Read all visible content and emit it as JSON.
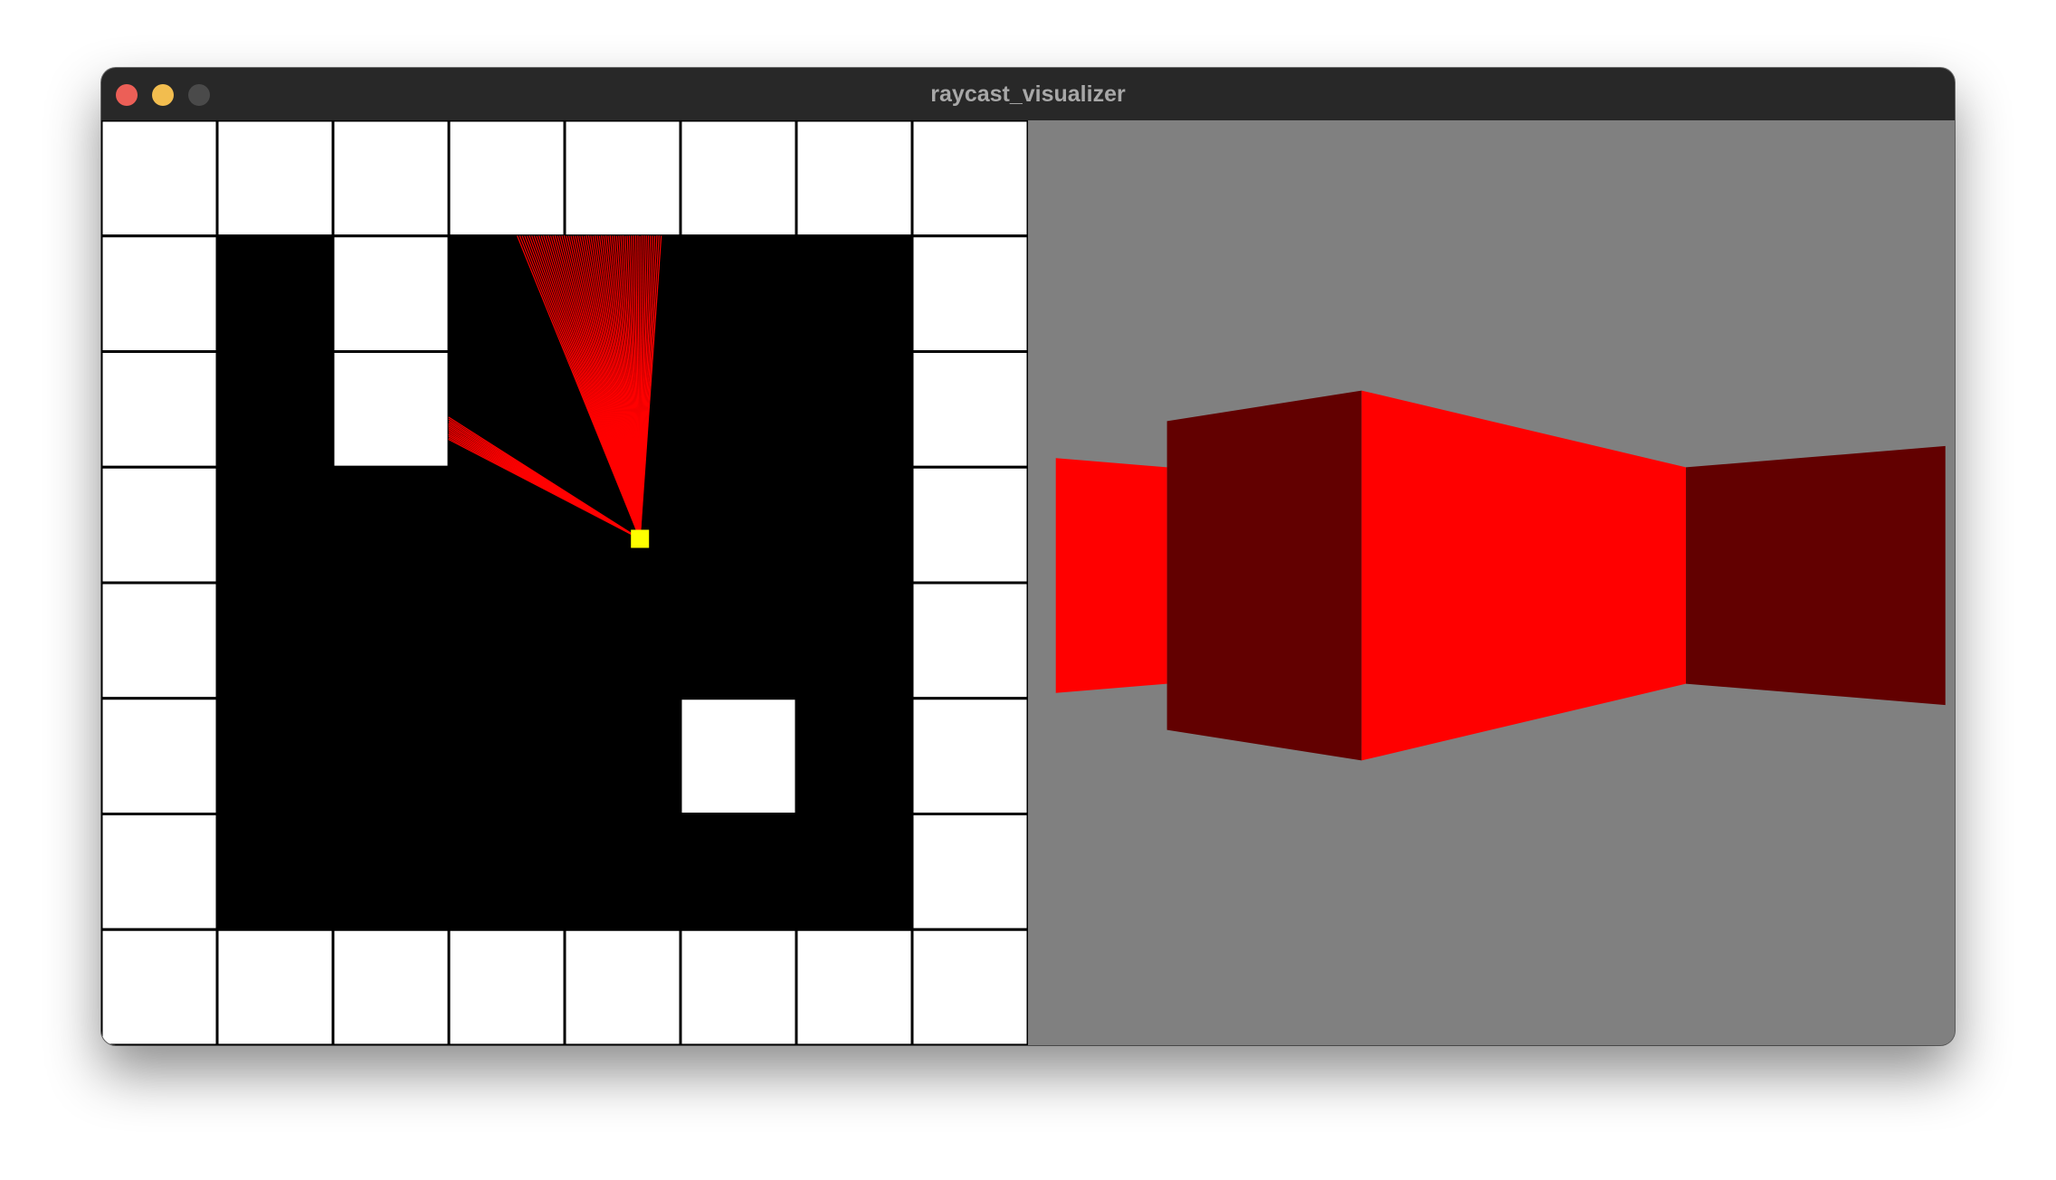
{
  "window": {
    "title": "raycast_visualizer",
    "traffic_lights": {
      "close_color": "#ec5f57",
      "minimize_color": "#f2bd4f",
      "zoom_color": "#4a4a4a"
    }
  },
  "map": {
    "rows": 8,
    "cols": 8,
    "grid": [
      [
        1,
        1,
        1,
        1,
        1,
        1,
        1,
        1
      ],
      [
        1,
        0,
        1,
        0,
        0,
        0,
        0,
        1
      ],
      [
        1,
        0,
        1,
        0,
        0,
        0,
        0,
        1
      ],
      [
        1,
        0,
        0,
        0,
        0,
        0,
        0,
        1
      ],
      [
        1,
        0,
        0,
        0,
        0,
        0,
        0,
        1
      ],
      [
        1,
        0,
        0,
        0,
        0,
        1,
        0,
        1
      ],
      [
        1,
        0,
        0,
        0,
        0,
        0,
        0,
        1
      ],
      [
        1,
        1,
        1,
        1,
        1,
        1,
        1,
        1
      ]
    ],
    "wall_color": "#ffffff",
    "floor_color": "#000000",
    "grid_line_color": "#000000",
    "player": {
      "col": 4.65,
      "row": 3.62,
      "color": "#ffff00"
    },
    "ray_color": "#ff0000",
    "rays": {
      "group_a": {
        "count": 14,
        "from_angle_deg": 212.5,
        "to_angle_deg": 207.5
      },
      "group_b": {
        "count": 66,
        "from_angle_deg": 248.0,
        "to_angle_deg": 274.0
      }
    }
  },
  "render_view": {
    "background_color": "#808080",
    "bright_wall_color": "#ff0000",
    "dark_wall_color": "#620000",
    "wall_strips": [
      {
        "shade": "bright",
        "from": 0.03,
        "to": 0.15,
        "left_height": 0.127,
        "right_height": 0.117
      },
      {
        "shade": "dark",
        "from": 0.15,
        "to": 0.36,
        "left_height": 0.167,
        "right_height": 0.2
      },
      {
        "shade": "bright",
        "from": 0.36,
        "to": 0.71,
        "left_height": 0.2,
        "right_height": 0.117
      },
      {
        "shade": "dark",
        "from": 0.71,
        "to": 0.99,
        "left_height": 0.117,
        "right_height": 0.14
      }
    ]
  }
}
